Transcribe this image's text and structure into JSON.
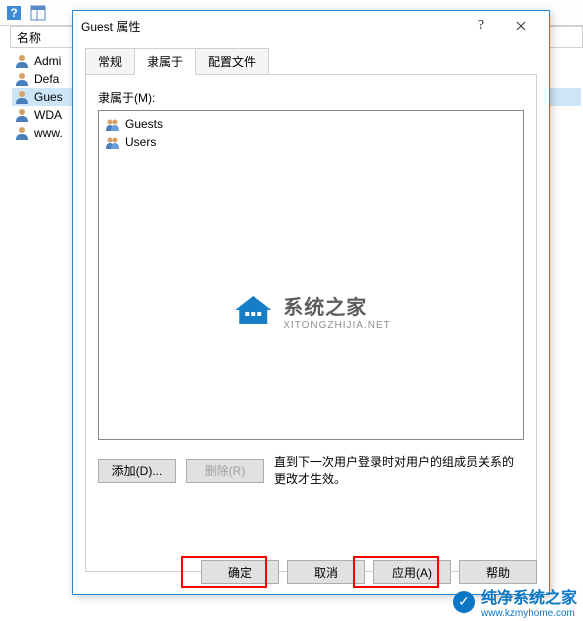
{
  "toolbar": {
    "help_icon": "help-icon",
    "panel_icon": "panel-icon"
  },
  "column_header": "名称",
  "users": [
    {
      "name": "Admi"
    },
    {
      "name": "Defa"
    },
    {
      "name": "Gues"
    },
    {
      "name": "WDA"
    },
    {
      "name": "www."
    }
  ],
  "dialog": {
    "title": "Guest 属性",
    "tabs": {
      "general": "常规",
      "memberof": "隶属于",
      "profile": "配置文件"
    },
    "memberof_label": "隶属于(M):",
    "groups": [
      "Guests",
      "Users"
    ],
    "add_btn": "添加(D)...",
    "remove_btn": "删除(R)",
    "note": "直到下一次用户登录时对用户的组成员关系的更改才生效。",
    "ok": "确定",
    "cancel": "取消",
    "apply": "应用(A)",
    "help": "帮助"
  },
  "watermark_center": {
    "cn": "系统之家",
    "en": "XITONGZHIJIA.NET"
  },
  "watermark_bottom": {
    "cn": "纯净系统之家",
    "en": "www.kzmyhome.com"
  }
}
